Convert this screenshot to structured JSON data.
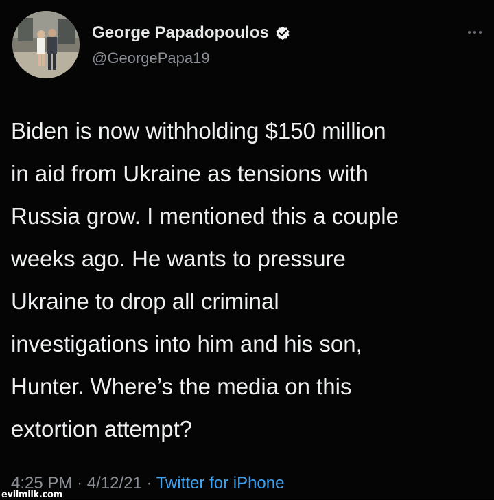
{
  "tweet": {
    "author": {
      "display_name": "George Papadopoulos",
      "handle": "@GeorgePapa19",
      "verified_icon": "verified-badge-icon"
    },
    "more_icon": "more-options-icon",
    "text": "Biden is now withholding $150 million\nin aid from Ukraine as tensions with\nRussia grow. I mentioned this a couple\nweeks ago. He wants to pressure\nUkraine to drop all criminal\ninvestigations into him and his son,\nHunter. Where’s the media on this\nextortion attempt?",
    "time": "4:25 PM",
    "separator": "·",
    "date": "4/12/21",
    "source": "Twitter for iPhone"
  },
  "watermark": "evilmilk.com",
  "colors": {
    "background": "#050505",
    "text": "#eef0f1",
    "secondary": "#8b9096",
    "link": "#3da2f0"
  }
}
